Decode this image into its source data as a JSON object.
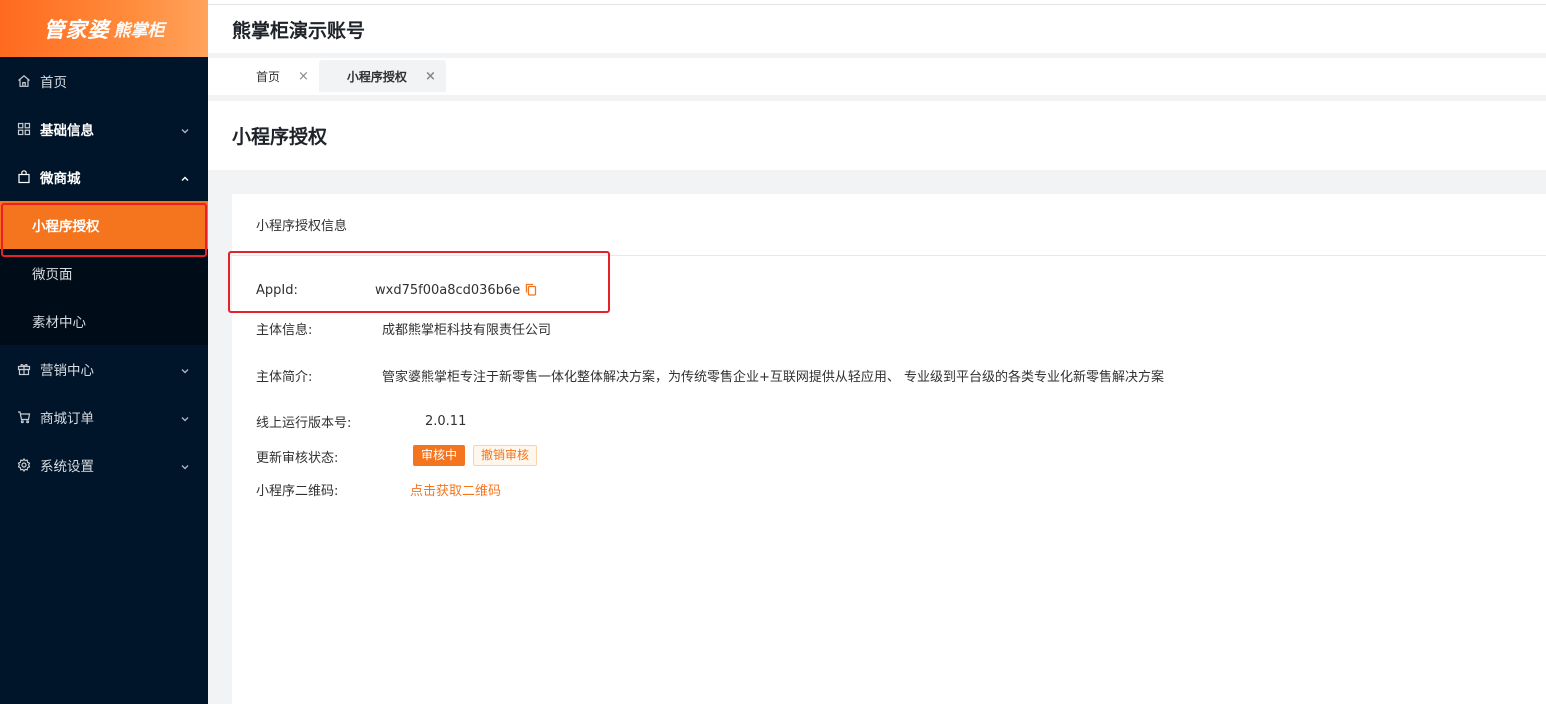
{
  "logo": {
    "main": "管家婆",
    "sub": "熊掌柜"
  },
  "sidebar": {
    "items": [
      {
        "label": "首页",
        "icon": "home-icon"
      },
      {
        "label": "基础信息",
        "icon": "grid-icon",
        "expandable": true
      },
      {
        "label": "微商城",
        "icon": "shopping-bag-icon",
        "expanded": true,
        "children": [
          {
            "label": "小程序授权",
            "active": true
          },
          {
            "label": "微页面"
          },
          {
            "label": "素材中心"
          }
        ]
      },
      {
        "label": "营销中心",
        "icon": "gift-icon",
        "expandable": true
      },
      {
        "label": "商城订单",
        "icon": "cart-icon",
        "expandable": true
      },
      {
        "label": "系统设置",
        "icon": "gear-icon",
        "expandable": true
      }
    ]
  },
  "header": {
    "title": "熊掌柜演示账号"
  },
  "tabs": [
    {
      "label": "首页",
      "close": "×"
    },
    {
      "label": "小程序授权",
      "close": "×",
      "active": true
    }
  ],
  "page": {
    "title": "小程序授权"
  },
  "card": {
    "title": "小程序授权信息",
    "appid_label": "AppId:",
    "appid_value": "wxd75f00a8cd036b6e",
    "entity_label": "主体信息:",
    "entity_value": "成都熊掌柜科技有限责任公司",
    "intro_label": "主体简介:",
    "intro_value": "管家婆熊掌柜专注于新零售一体化整体解决方案，为传统零售企业+互联网提供从轻应用、 专业级到平台级的各类专业化新零售解决方案",
    "version_label": "线上运行版本号:",
    "version_value": "2.0.11",
    "review_label": "更新审核状态:",
    "review_status": "审核中",
    "review_cancel": "撤销审核",
    "qrcode_label": "小程序二维码:",
    "qrcode_link": "点击获取二维码"
  },
  "colors": {
    "accent": "#f5751f",
    "sidebar_bg": "#001529",
    "highlight_border": "#e8202a"
  }
}
